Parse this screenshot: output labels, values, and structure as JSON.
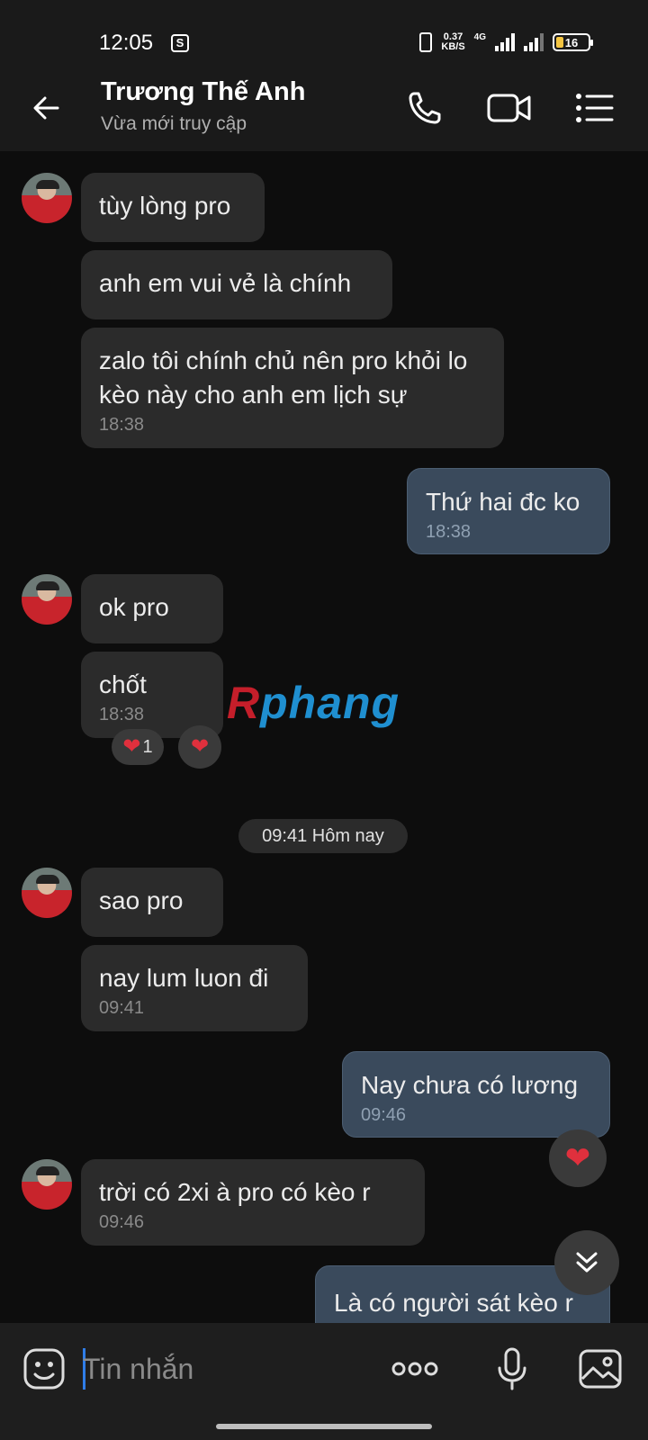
{
  "status_bar": {
    "time": "12:05",
    "shop_icon": "shopping-bag-icon",
    "speed_value": "0.37",
    "speed_unit": "KB/S",
    "network": "4G",
    "battery": "16"
  },
  "header": {
    "contact_name": "Trương Thế Anh",
    "status": "Vừa mới truy cập",
    "icons": [
      "back-arrow-icon",
      "phone-icon",
      "video-call-icon",
      "menu-list-icon"
    ]
  },
  "messages": [
    {
      "sender": "them",
      "text": "tùy lòng pro"
    },
    {
      "sender": "them",
      "text": "anh em vui vẻ là chính"
    },
    {
      "sender": "them",
      "text": "zalo tôi chính chủ nên pro khỏi lo kèo này cho anh em lịch sự",
      "time": "18:38"
    },
    {
      "sender": "me",
      "text": "Thứ hai đc ko",
      "time": "18:38"
    },
    {
      "sender": "them",
      "text": "ok pro"
    },
    {
      "sender": "them",
      "text": "chốt",
      "time": "18:38",
      "reaction_count": "1"
    },
    {
      "sender": "them",
      "text": "sao pro"
    },
    {
      "sender": "them",
      "text": "nay lum luon đi",
      "time": "09:41"
    },
    {
      "sender": "me",
      "text": "Nay chưa có lương",
      "time": "09:46"
    },
    {
      "sender": "them",
      "text": "trời có 2xi à pro có kèo r",
      "time": "09:46"
    },
    {
      "sender": "me",
      "text": "Là có người sát kèo r"
    }
  ],
  "date_divider": "09:41 Hôm nay",
  "watermark": {
    "first": "R",
    "rest": "phang"
  },
  "input_bar": {
    "placeholder": "Tin nhắn",
    "icons": [
      "sticker-icon",
      "more-dots-icon",
      "microphone-icon",
      "image-icon"
    ]
  },
  "colors": {
    "my_bubble": "#3a4a5c",
    "their_bubble": "#2b2b2b",
    "heart": "#e0303d"
  }
}
